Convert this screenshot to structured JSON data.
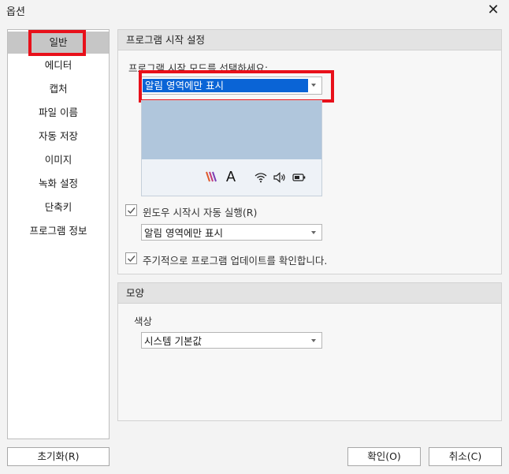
{
  "window": {
    "title": "옵션",
    "close_label": "✕"
  },
  "sidebar": {
    "items": [
      {
        "label": "일반"
      },
      {
        "label": "에디터"
      },
      {
        "label": "캡처"
      },
      {
        "label": "파일 이름"
      },
      {
        "label": "자동 저장"
      },
      {
        "label": "이미지"
      },
      {
        "label": "녹화 설정"
      },
      {
        "label": "단축키"
      },
      {
        "label": "프로그램 정보"
      }
    ]
  },
  "startup": {
    "header": "프로그램 시작 설정",
    "mode_label": "프로그램 시작 모드를 선택하세요:",
    "mode_value": "알림 영역에만 표시",
    "tray_letter": "A",
    "autorun_label": "윈도우 시작시 자동 실행(R)",
    "autorun_checked": true,
    "autorun_mode_value": "알림 영역에만 표시",
    "update_label": "주기적으로 프로그램 업데이트를 확인합니다.",
    "update_checked": true
  },
  "appearance": {
    "header": "모양",
    "color_label": "색상",
    "color_value": "시스템 기본값"
  },
  "buttons": {
    "reset": "초기화(R)",
    "ok": "확인(O)",
    "cancel": "취소(C)"
  },
  "colors": {
    "highlight": "#e8101a",
    "selection": "#0a64d6"
  }
}
